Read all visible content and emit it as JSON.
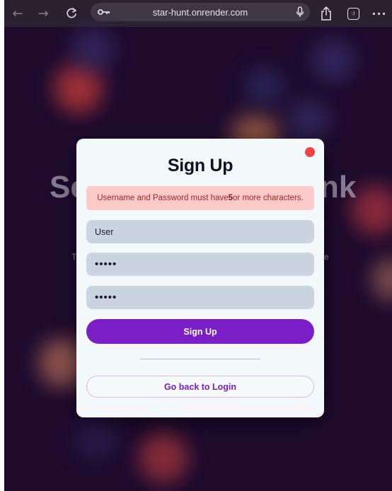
{
  "browser": {
    "url": "star-hunt.onrender.com",
    "back_icon": "arrow-left-icon",
    "forward_icon": "arrow-right-icon",
    "reload_icon": "reload-icon",
    "key_icon": "key-icon",
    "mic_icon": "microphone-icon",
    "share_icon": "share-icon",
    "tabs_icon": "tabs-icon",
    "more_icon": "more-icon",
    "tab_badge": ":)"
  },
  "background": {
    "headline_left": "Se",
    "headline_right": "nk",
    "small_left": "T",
    "small_right": "e"
  },
  "modal": {
    "title": "Sign Up",
    "alert": {
      "before": "Username and Password must have ",
      "emphasis": "5",
      "after": " or more characters."
    },
    "username_value": "User",
    "password_value": "•••••",
    "confirm_password_value": "•••••",
    "submit_label": "Sign Up",
    "back_label": "Go back to Login"
  },
  "colors": {
    "accent": "#7b1ec8",
    "close": "#ef4444",
    "alert_bg": "#fdcaca",
    "background": "#1e0b2e"
  }
}
